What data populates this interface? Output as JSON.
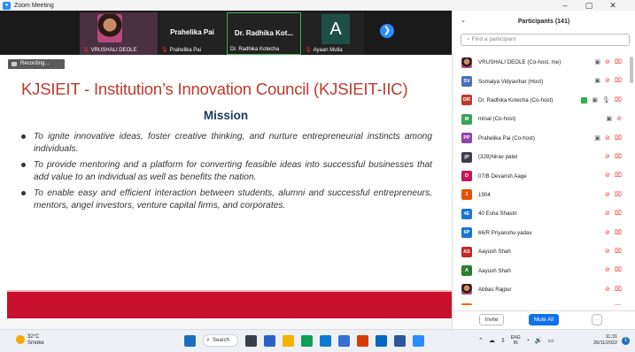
{
  "window": {
    "title": "Zoom Meeting",
    "controls": [
      "–",
      "▢",
      "✕"
    ]
  },
  "gallery": {
    "tiles": [
      {
        "display": "",
        "label": "VRUSHALI DEOLE",
        "type": "video"
      },
      {
        "display": "Prahelika Pai",
        "label": "Prahelika Pai",
        "type": "name"
      },
      {
        "display": "Dr. Radhika Kot...",
        "label": "Dr. Radhika Kotecha",
        "type": "name"
      },
      {
        "display": "A",
        "label": "Ayaan Mulla",
        "type": "avatar"
      }
    ],
    "next_icon": "❯"
  },
  "recording_label": "Recording...",
  "slide": {
    "title": "KJSIEIT - Institution’s Innovation Council (KJSIEIT-IIC)",
    "heading": "Mission",
    "bullets": [
      "To ignite innovative ideas, foster creative thinking, and nurture entrepreneurial instincts among individuals.",
      "To provide mentoring and a platform for converting feasible ideas into successful businesses that add value to an individual as well as benefits the nation.",
      "To enable easy and efficient interaction between students, alumni and successful entrepreneurs, mentors, angel investors, venture capital firms, and corporates."
    ],
    "band_color": "#c8102e"
  },
  "participants_panel": {
    "title": "Participants (141)",
    "collapse_icon": "⌄",
    "search_placeholder": "Find a participant",
    "participants": [
      {
        "initials": "",
        "name": "VRUSHALI DEOLE (Co-host, me)",
        "color": "photo",
        "icons": [
          "cam-on",
          "mic-off",
          "cam-off"
        ]
      },
      {
        "initials": "SV",
        "name": "Somaiya Vidyavihar (Host)",
        "color": "#4a6fbf",
        "icons": [
          "cam-on",
          "mic-off",
          "cam-off"
        ]
      },
      {
        "initials": "DR",
        "name": "Dr. Radhika Kotecha (Co-host)",
        "color": "#c0392b",
        "icons": [
          "share",
          "cam-on",
          "mic",
          "cam-off"
        ]
      },
      {
        "initials": "M",
        "name": "minal (Co-host)",
        "color": "#3aa15a",
        "icons": [
          "cam-on",
          "mic-off"
        ]
      },
      {
        "initials": "PP",
        "name": "Prahelika Pai (Co-host)",
        "color": "#8e44ad",
        "icons": [
          "cam-on",
          "mic-off",
          "cam-off"
        ]
      },
      {
        "initials": "(P",
        "name": "(328)Nirav patel",
        "color": "#3d3d4f",
        "icons": [
          "mic-off",
          "cam-off"
        ]
      },
      {
        "initials": "D",
        "name": "07/B Devansh Aage",
        "color": "#c2185b",
        "icons": [
          "mic-off",
          "cam-off"
        ]
      },
      {
        "initials": "1",
        "name": "1904",
        "color": "#e65100",
        "icons": [
          "mic-off",
          "cam-off"
        ]
      },
      {
        "initials": "4E",
        "name": "40 Esha Shastri",
        "color": "#1976d2",
        "icons": [
          "mic-off",
          "cam-off"
        ]
      },
      {
        "initials": "6P",
        "name": "66/R  Priyanshu yadav",
        "color": "#1976d2",
        "icons": [
          "mic-off",
          "cam-off"
        ]
      },
      {
        "initials": "AS",
        "name": "Aayush Shah",
        "color": "#c62828",
        "icons": [
          "mic-off",
          "cam-off"
        ]
      },
      {
        "initials": "A",
        "name": "Aayush Shah",
        "color": "#2e7d32",
        "icons": [
          "mic-off",
          "cam-off"
        ]
      },
      {
        "initials": "",
        "name": "Abbas Rajpur",
        "color": "photo",
        "icons": [
          "mic-off",
          "cam-off"
        ]
      },
      {
        "initials": "AK",
        "name": "Abdul Kadir Khan",
        "color": "#ef6c00",
        "icons": [
          "mic-off",
          "cam-off"
        ]
      }
    ],
    "footer": {
      "invite": "Invite",
      "mute_all": "Mute All",
      "more": "···"
    }
  },
  "taskbar": {
    "weather_temp": "32°C",
    "weather_desc": "Smoke",
    "search_label": "Search",
    "tray_lang_1": "ENG",
    "tray_lang_2": "IN",
    "time": "11:31",
    "date": "26/11/2022",
    "notifications": "1",
    "app_icons": [
      {
        "name": "start-icon",
        "color": "#1b6ec2"
      },
      {
        "name": "taskview-icon",
        "color": "#3a3f4a"
      },
      {
        "name": "widgets-icon",
        "color": "#2a63c7"
      },
      {
        "name": "explorer-icon",
        "color": "#f2b400"
      },
      {
        "name": "chrome-icon",
        "color": "#0f9d58"
      },
      {
        "name": "edge-icon",
        "color": "#0a7bd1"
      },
      {
        "name": "store-icon",
        "color": "#3870d8"
      },
      {
        "name": "mail-icon",
        "color": "#d83b01"
      },
      {
        "name": "teams-icon",
        "color": "#0067c0"
      },
      {
        "name": "word-icon",
        "color": "#2b579a"
      },
      {
        "name": "zoom-icon",
        "color": "#2d8cff"
      }
    ]
  }
}
